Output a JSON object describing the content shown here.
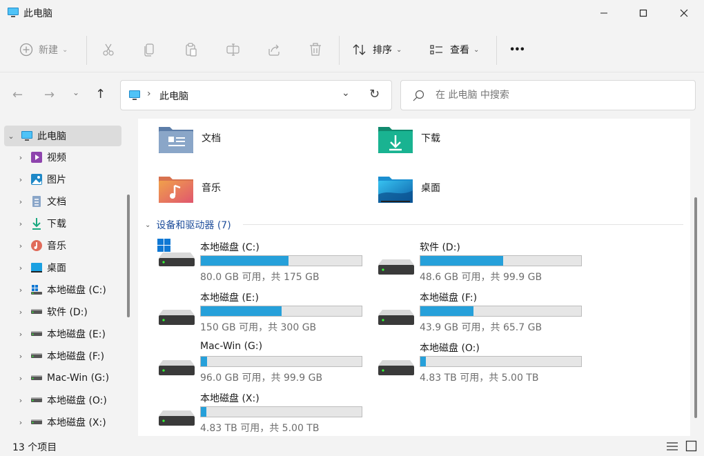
{
  "window": {
    "title": "此电脑"
  },
  "toolbar": {
    "new_label": "新建",
    "sort_label": "排序",
    "view_label": "查看",
    "more_label": "•••"
  },
  "address": {
    "path": "此电脑",
    "search_placeholder": "在 此电脑 中搜索"
  },
  "sidebar": {
    "items": [
      {
        "label": "此电脑",
        "icon": "pc-icon"
      },
      {
        "label": "视频",
        "icon": "video-icon"
      },
      {
        "label": "图片",
        "icon": "pictures-icon"
      },
      {
        "label": "文档",
        "icon": "documents-icon"
      },
      {
        "label": "下载",
        "icon": "download-icon"
      },
      {
        "label": "音乐",
        "icon": "music-icon"
      },
      {
        "label": "桌面",
        "icon": "desktop-icon"
      },
      {
        "label": "本地磁盘 (C:)",
        "icon": "windows-drive-icon"
      },
      {
        "label": "软件 (D:)",
        "icon": "drive-icon"
      },
      {
        "label": "本地磁盘 (E:)",
        "icon": "drive-icon"
      },
      {
        "label": "本地磁盘 (F:)",
        "icon": "drive-icon"
      },
      {
        "label": "Mac-Win (G:)",
        "icon": "drive-icon"
      },
      {
        "label": "本地磁盘 (O:)",
        "icon": "drive-icon"
      },
      {
        "label": "本地磁盘 (X:)",
        "icon": "drive-icon"
      }
    ]
  },
  "folders": [
    {
      "name": "文档"
    },
    {
      "name": "下载"
    },
    {
      "name": "音乐"
    },
    {
      "name": "桌面"
    }
  ],
  "devices_header": "设备和驱动器 (7)",
  "drives": [
    {
      "name": "本地磁盘 (C:)",
      "free_text": "80.0 GB 可用，共 175 GB",
      "used_fraction": 0.543
    },
    {
      "name": "软件 (D:)",
      "free_text": "48.6 GB 可用，共 99.9 GB",
      "used_fraction": 0.513
    },
    {
      "name": "本地磁盘 (E:)",
      "free_text": "150 GB 可用，共 300 GB",
      "used_fraction": 0.5
    },
    {
      "name": "本地磁盘 (F:)",
      "free_text": "43.9 GB 可用，共 65.7 GB",
      "used_fraction": 0.332
    },
    {
      "name": "Mac-Win (G:)",
      "free_text": "96.0 GB 可用，共 99.9 GB",
      "used_fraction": 0.039
    },
    {
      "name": "本地磁盘 (O:)",
      "free_text": "4.83 TB 可用，共 5.00 TB",
      "used_fraction": 0.034
    },
    {
      "name": "本地磁盘 (X:)",
      "free_text": "4.83 TB 可用，共 5.00 TB",
      "used_fraction": 0.034
    }
  ],
  "status": {
    "item_count": "13 个项目"
  },
  "colors": {
    "accent": "#26a0da",
    "section_header": "#1f4e9b"
  }
}
